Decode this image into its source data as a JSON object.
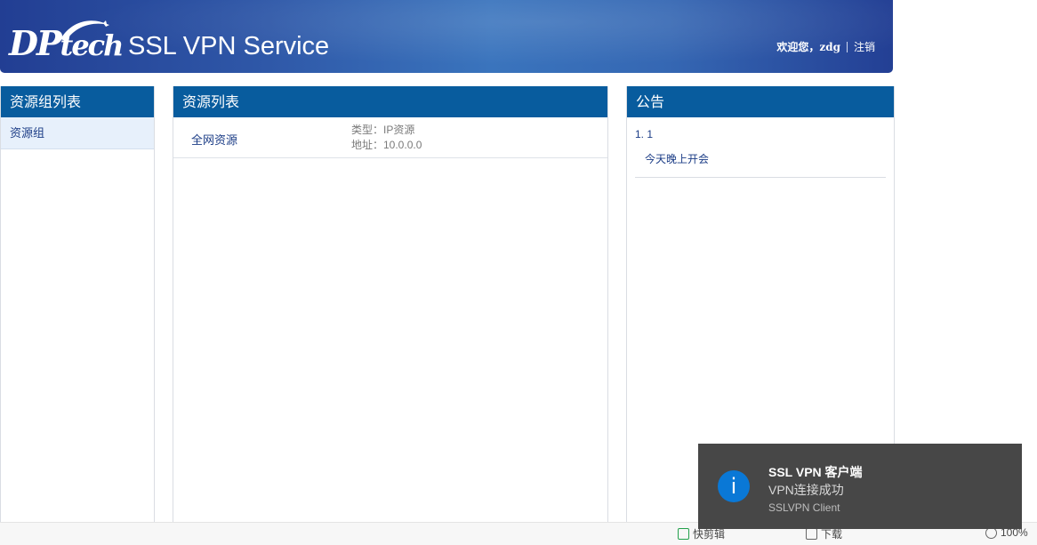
{
  "header": {
    "logo_main": "DP",
    "logo_sub": "tech",
    "title": "SSL VPN Service",
    "welcome": "欢迎您，zdg",
    "logout": "注销"
  },
  "groups_panel": {
    "title": "资源组列表",
    "items": [
      {
        "label": "资源组"
      }
    ]
  },
  "resources_panel": {
    "title": "资源列表",
    "items": [
      {
        "name": "全网资源",
        "type": "类型：IP资源",
        "address": "地址：10.0.0.0"
      }
    ]
  },
  "notice_panel": {
    "title": "公告",
    "items": [
      {
        "title": "1. 1",
        "body": "今天晚上开会"
      }
    ]
  },
  "statusbar": {
    "items": [
      {
        "icon": "clip-icon",
        "label": "快剪辑"
      },
      {
        "icon": "download-icon",
        "label": "下载"
      },
      {
        "icon": "zoom-icon",
        "label": "100%"
      }
    ]
  },
  "toast": {
    "icon": "i",
    "title": "SSL VPN 客户端",
    "message": "VPN连接成功",
    "app": "SSLVPN Client",
    "accent": "#0a78d6"
  }
}
